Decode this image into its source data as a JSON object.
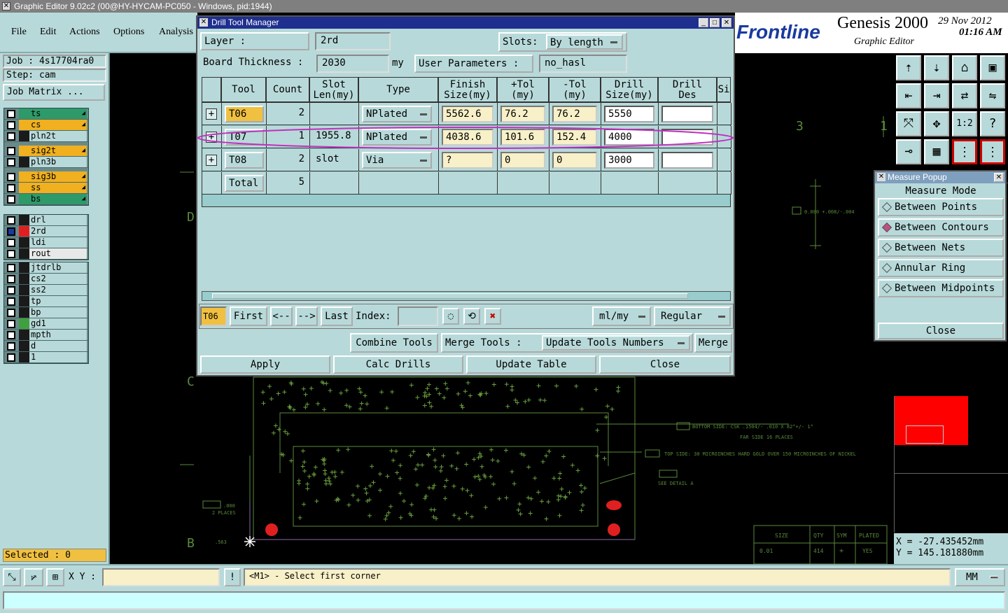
{
  "window": {
    "title": "Graphic Editor 9.02c2 (00@HY-HYCAM-PC050 - Windows, pid:1944)"
  },
  "menu": [
    "File",
    "Edit",
    "Actions",
    "Options",
    "Analysis"
  ],
  "job": {
    "job_label": "Job : 4s17704ra0",
    "step_label": "Step: cam",
    "matrix_button": "Job Matrix ..."
  },
  "layers_g1": [
    {
      "name": "ts",
      "color": "#2e9a6a",
      "bg": "#2e9a6a",
      "mark": "◢"
    },
    {
      "name": "cs",
      "color": "#f0b020",
      "bg": "#f0b020",
      "mark": "◢"
    },
    {
      "name": "pln2t",
      "color": "#1a1a1a",
      "bg": "#b8d9d9",
      "mark": ""
    },
    {
      "name": "sig2t",
      "color": "#f0b020",
      "bg": "#f0b020",
      "mark": "◢"
    },
    {
      "name": "pln3b",
      "color": "#1a1a1a",
      "bg": "#b8d9d9",
      "mark": ""
    },
    {
      "name": "sig3b",
      "color": "#f0b020",
      "bg": "#f0b020",
      "mark": "◢"
    },
    {
      "name": "ss",
      "color": "#f0b020",
      "bg": "#f0b020",
      "mark": "◢"
    },
    {
      "name": "bs",
      "color": "#2e9a6a",
      "bg": "#2e9a6a",
      "mark": "◢"
    }
  ],
  "layers_g2": [
    {
      "name": "drl",
      "color": "#1a1a1a",
      "bg": "#b8d9d9"
    },
    {
      "name": "2rd",
      "color": "#e02020",
      "bg": "#b8d9d9"
    },
    {
      "name": "ldi",
      "color": "#1a1a1a",
      "bg": "#b8d9d9"
    },
    {
      "name": "rout",
      "color": "#1a1a1a",
      "bg": "#e8e8e8"
    }
  ],
  "layers_g3": [
    {
      "name": "jtdrlb",
      "color": "#1a1a1a"
    },
    {
      "name": "cs2",
      "color": "#1a1a1a"
    },
    {
      "name": "ss2",
      "color": "#1a1a1a"
    },
    {
      "name": "tp",
      "color": "#1a1a1a"
    },
    {
      "name": "bp",
      "color": "#1a1a1a"
    },
    {
      "name": "gd1",
      "color": "#40a040"
    },
    {
      "name": "mpth",
      "color": "#1a1a1a"
    },
    {
      "name": "d",
      "color": "#1a1a1a"
    },
    {
      "name": "1",
      "color": "#1a1a1a"
    }
  ],
  "selected": "Selected : 0",
  "brand": {
    "logo": "Frontline",
    "product": "Genesis 2000",
    "date": "29 Nov 2012",
    "time": "01:16 AM",
    "subtitle": "Graphic Editor"
  },
  "dtm": {
    "title": "Drill Tool Manager",
    "layer_label": "Layer        :",
    "layer_value": "2rd",
    "slots_label": "Slots:",
    "slots_value": "By length",
    "thickness_label": "Board Thickness :",
    "thickness_value": "2030",
    "thickness_unit": "my",
    "user_params_label": "User Parameters  :",
    "user_params_value": "no_hasl",
    "headers": [
      "Tool",
      "Count",
      "Slot\nLen(my)",
      "Type",
      "Finish\nSize(my)",
      "+Tol\n(my)",
      "-Tol\n(my)",
      "Drill\nSize(my)",
      "Drill\nDes",
      "Si"
    ],
    "rows": [
      {
        "tool": "T06",
        "count": "2",
        "slot": "",
        "type": "NPlated",
        "finish": "5562.6",
        "ptol": "76.2",
        "mtol": "76.2",
        "drill": "5550",
        "des": ""
      },
      {
        "tool": "T07",
        "count": "1",
        "slot": "1955.8",
        "type": "NPlated",
        "finish": "4038.6",
        "ptol": "101.6",
        "mtol": "152.4",
        "drill": "4000",
        "des": ""
      },
      {
        "tool": "T08",
        "count": "2",
        "slot": "slot",
        "type": "Via",
        "finish": "?",
        "ptol": "0",
        "mtol": "0",
        "drill": "3000",
        "des": ""
      }
    ],
    "total_label": "Total",
    "total_count": "5",
    "nav": {
      "current": "T06",
      "first": "First",
      "prev": "<--",
      "next": "-->",
      "last": "Last",
      "index_label": "Index:",
      "units": "ml/my",
      "mode": "Regular"
    },
    "combine": "Combine Tools",
    "merge_label": "Merge Tools :",
    "merge_option": "Update Tools Numbers",
    "merge_btn": "Merge",
    "apply": "Apply",
    "calc": "Calc Drills",
    "update": "Update Table",
    "close": "Close"
  },
  "measure": {
    "title": "Measure Popup",
    "mode_label": "Measure Mode",
    "options": [
      "Between Points",
      "Between Contours",
      "Between Nets",
      "Annular Ring",
      "Between Midpoints"
    ],
    "selected_index": 1,
    "close": "Close"
  },
  "coords": {
    "x": "X  = -27.435452mm",
    "y": "Y  =  145.181880mm"
  },
  "status": {
    "xy_label": "X Y :",
    "message": "<M1> - Select first corner",
    "units": "MM"
  },
  "canvas_text": {
    "labels": [
      "D",
      "C",
      "B",
      "3",
      "1"
    ],
    "note_tol": "0.080 +.008/-.004",
    "note_bottom": "BOTTOM SIDE: CSK .1504/- .010 X 82°+/- 1°",
    "note_far": "FAR SIDE 16 PLACES",
    "note_top": "TOP SIDE: 30 MICROINCHES HARD GOLD OVER 150 MICROINCHES OF NICKEL",
    "note_detail": "SEE DETAIL A",
    "note_places": "2 PLACES",
    "note_dim": ".000",
    "note_563": ".563",
    "table_head": [
      "SIZE",
      "QTY",
      "SYM",
      "PLATED"
    ],
    "table_row": [
      "0.01",
      "414",
      "+",
      "YES"
    ]
  }
}
